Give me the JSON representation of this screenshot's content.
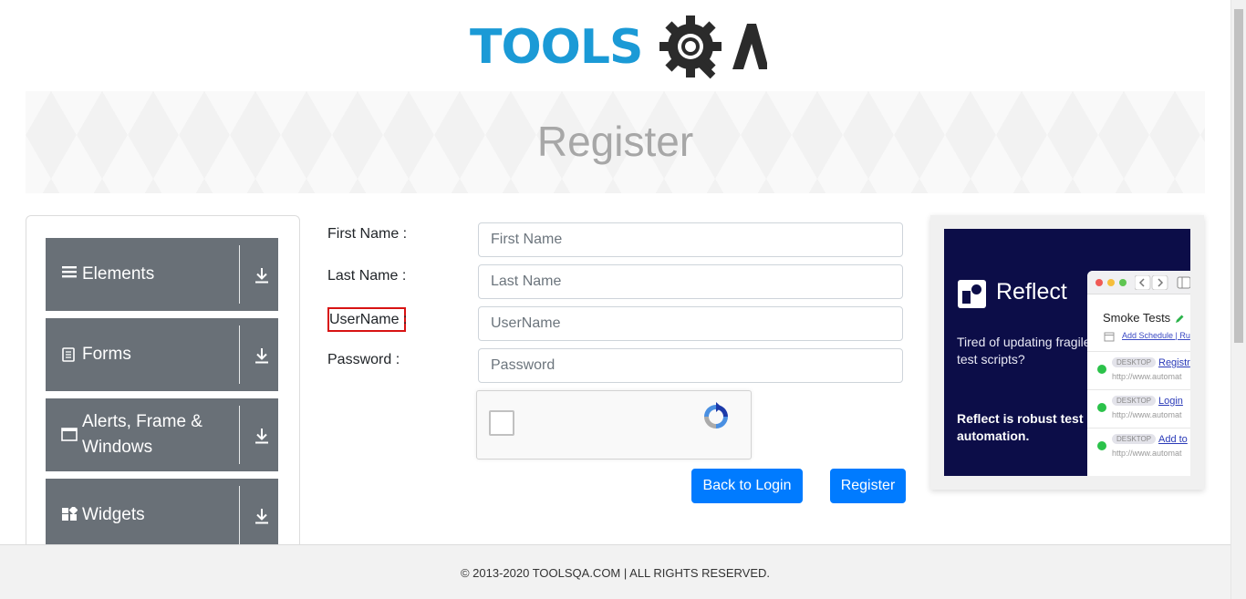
{
  "header": {
    "logo_text": "TOOLS",
    "logo_suffix": "QA"
  },
  "banner": {
    "title": "Register"
  },
  "sidebar": {
    "groups": [
      {
        "label": "Elements",
        "icon": "hamburger-icon"
      },
      {
        "label": "Forms",
        "icon": "document-icon"
      },
      {
        "label": "Alerts, Frame & Windows",
        "icon": "window-icon"
      },
      {
        "label": "Widgets",
        "icon": "widgets-icon"
      }
    ]
  },
  "form": {
    "first_name_label": "First Name :",
    "first_name_placeholder": "First Name",
    "last_name_label": "Last Name :",
    "last_name_placeholder": "Last Name",
    "username_label": "UserName :",
    "username_placeholder": "UserName",
    "password_label": "Password :",
    "password_placeholder": "Password",
    "back_to_login_label": "Back to Login",
    "register_label": "Register"
  },
  "ad": {
    "brand": "Reflect",
    "tagline": "Tired of updating fragile test scripts?",
    "pitch": "Reflect is robust test automation.",
    "window_title": "Smoke Tests",
    "window_subtitle": "Add Schedule  |  Ru",
    "rows": [
      {
        "tag": "DESKTOP",
        "link": "Registr",
        "url": "http://www.automat"
      },
      {
        "tag": "DESKTOP",
        "link": "Login",
        "url": "http://www.automat"
      },
      {
        "tag": "DESKTOP",
        "link": "Add to",
        "url": "http://www.automat"
      }
    ]
  },
  "footer": {
    "copyright": "© 2013-2020 TOOLSQA.COM | ALL RIGHTS RESERVED."
  },
  "colors": {
    "primary_button": "#007bff",
    "sidebar_group": "#697077",
    "logo_blue": "#1b9ad6",
    "highlight_border": "#d81313",
    "ad_background": "#0c0d48"
  }
}
